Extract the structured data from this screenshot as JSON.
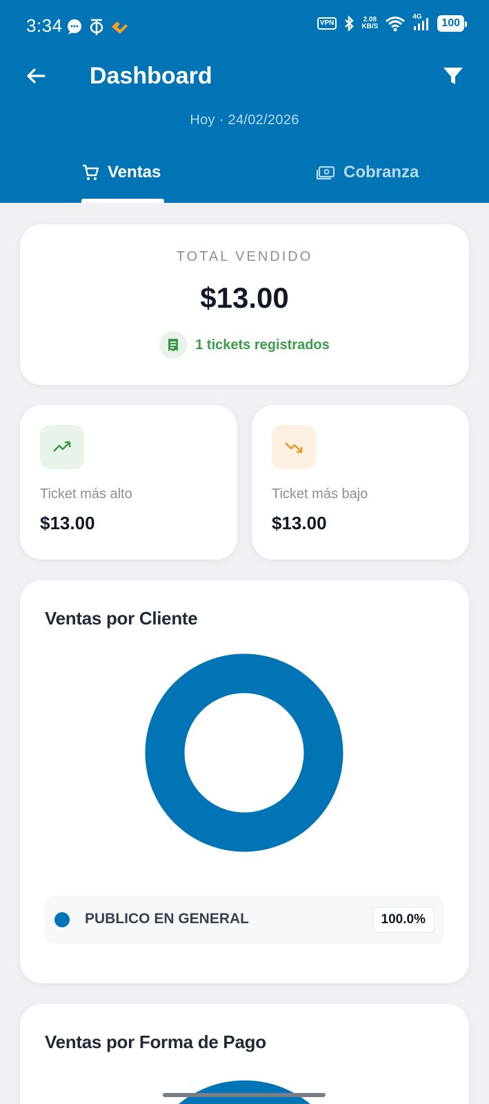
{
  "status_bar": {
    "time": "3:34",
    "vpn": "VPN",
    "speed_value": "2.08",
    "speed_unit": "KB/S",
    "network": "4G",
    "battery": "100"
  },
  "header": {
    "title": "Dashboard",
    "subtitle": "Hoy · 24/02/2026"
  },
  "tabs": [
    {
      "label": "Ventas",
      "icon": "cart-icon",
      "active": true
    },
    {
      "label": "Cobranza",
      "icon": "cash-icon",
      "active": false
    }
  ],
  "summary": {
    "label": "TOTAL VENDIDO",
    "amount": "$13.00",
    "tickets_text": "1 tickets registrados"
  },
  "stats": [
    {
      "label": "Ticket más alto",
      "value": "$13.00",
      "icon": "trending-up-icon",
      "color": "#3a9a48"
    },
    {
      "label": "Ticket más bajo",
      "value": "$13.00",
      "icon": "trending-down-icon",
      "color": "#e8951f"
    }
  ],
  "clients_chart": {
    "title": "Ventas por Cliente",
    "chart_data": {
      "type": "pie",
      "categories": [
        "PUBLICO EN GENERAL"
      ],
      "values": [
        100.0
      ],
      "colors": [
        "#0174b6"
      ]
    },
    "legend": [
      {
        "name": "PUBLICO EN GENERAL",
        "percent": "100.0%",
        "color": "#0174b6"
      }
    ]
  },
  "payment_chart": {
    "title": "Ventas por Forma de Pago"
  },
  "colors": {
    "primary": "#0174b6",
    "success": "#3a9a48",
    "warning": "#e8951f",
    "background": "#eff1f4"
  }
}
